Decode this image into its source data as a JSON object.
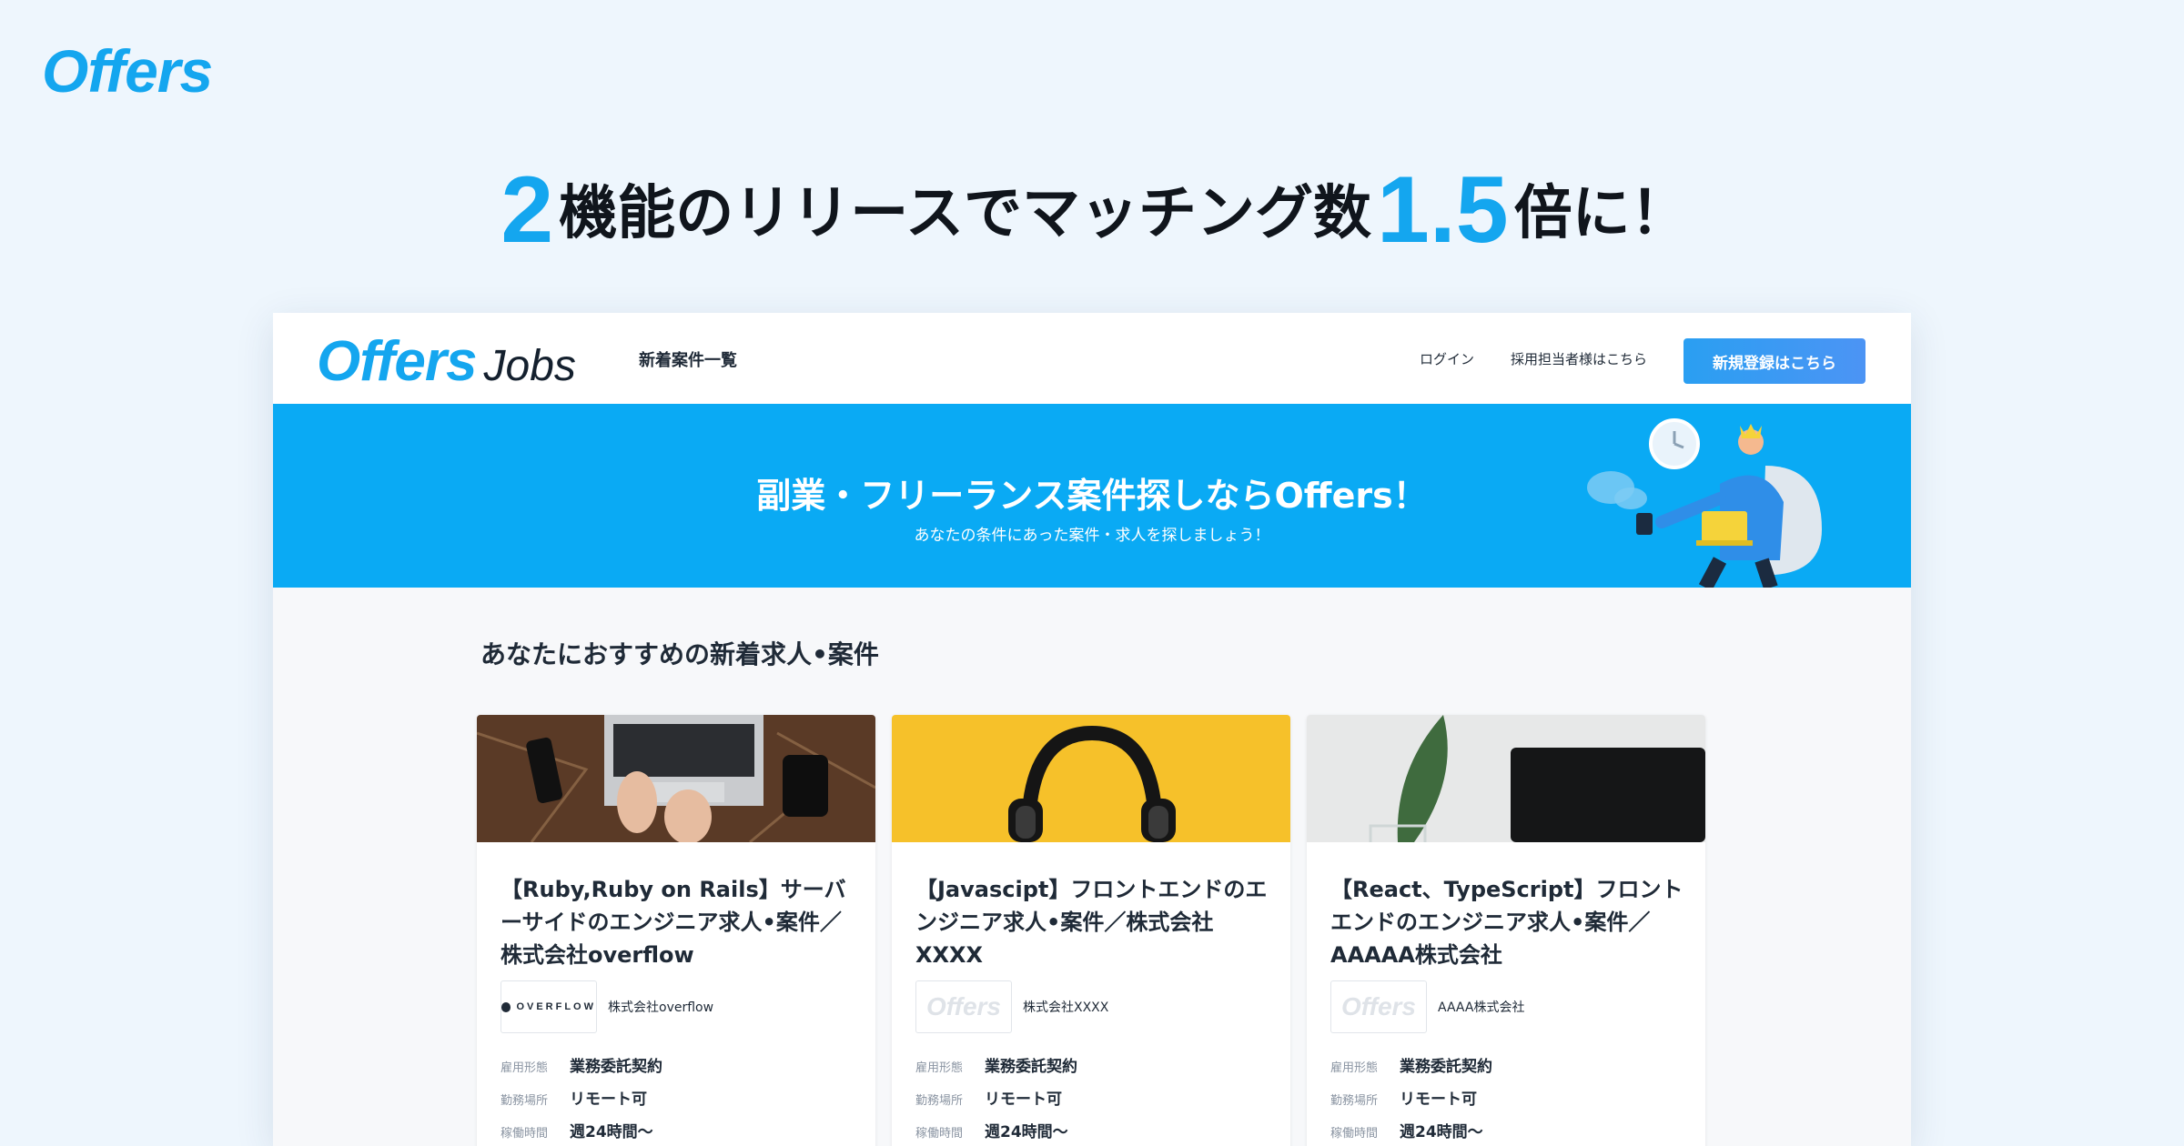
{
  "brand": {
    "logo_text": "Offers"
  },
  "headline": {
    "num1": "2",
    "text1": "機能のリリースでマッチング数",
    "num2": "1.5",
    "text2": "倍に！"
  },
  "site": {
    "header": {
      "logo_offers": "Offers",
      "logo_jobs": "Jobs",
      "nav_new": "新着案件一覧",
      "login": "ログイン",
      "recruiter": "採用担当者様はこちら",
      "signup": "新規登録はこちら"
    },
    "banner": {
      "title": "副業・フリーランス案件探しならOffers！",
      "subtitle": "あなたの条件にあった案件・求人を探しましょう！"
    },
    "section_title": "あなたにおすすめの新着求人•案件",
    "meta_labels": {
      "employment": "雇用形態",
      "location": "勤務場所",
      "hours": "稼働時間"
    },
    "cards": [
      {
        "title": "【Ruby,Ruby on Rails】サーバーサイドのエンジニア求人•案件／株式会社overflow",
        "company_logo": "OVERFLOW",
        "company_name": "株式会社overflow",
        "employment": "業務委託契約",
        "location": "リモート可",
        "hours": "週24時間〜"
      },
      {
        "title": "【Javascipt】フロントエンドのエンジニア求人•案件／株式会社XXXX",
        "company_logo": "Offers",
        "company_name": "株式会社XXXX",
        "employment": "業務委託契約",
        "location": "リモート可",
        "hours": "週24時間〜"
      },
      {
        "title": "【React、TypeScript】フロントエンドのエンジニア求人•案件／AAAAA株式会社",
        "company_logo": "Offers",
        "company_name": "AAAA株式会社",
        "employment": "業務委託契約",
        "location": "リモート可",
        "hours": "週24時間〜"
      }
    ]
  },
  "colors": {
    "brand_blue": "#14a6ef",
    "banner_blue": "#0aaaf4",
    "button_blue": "#2a9ff2",
    "background": "#eef6fd"
  }
}
